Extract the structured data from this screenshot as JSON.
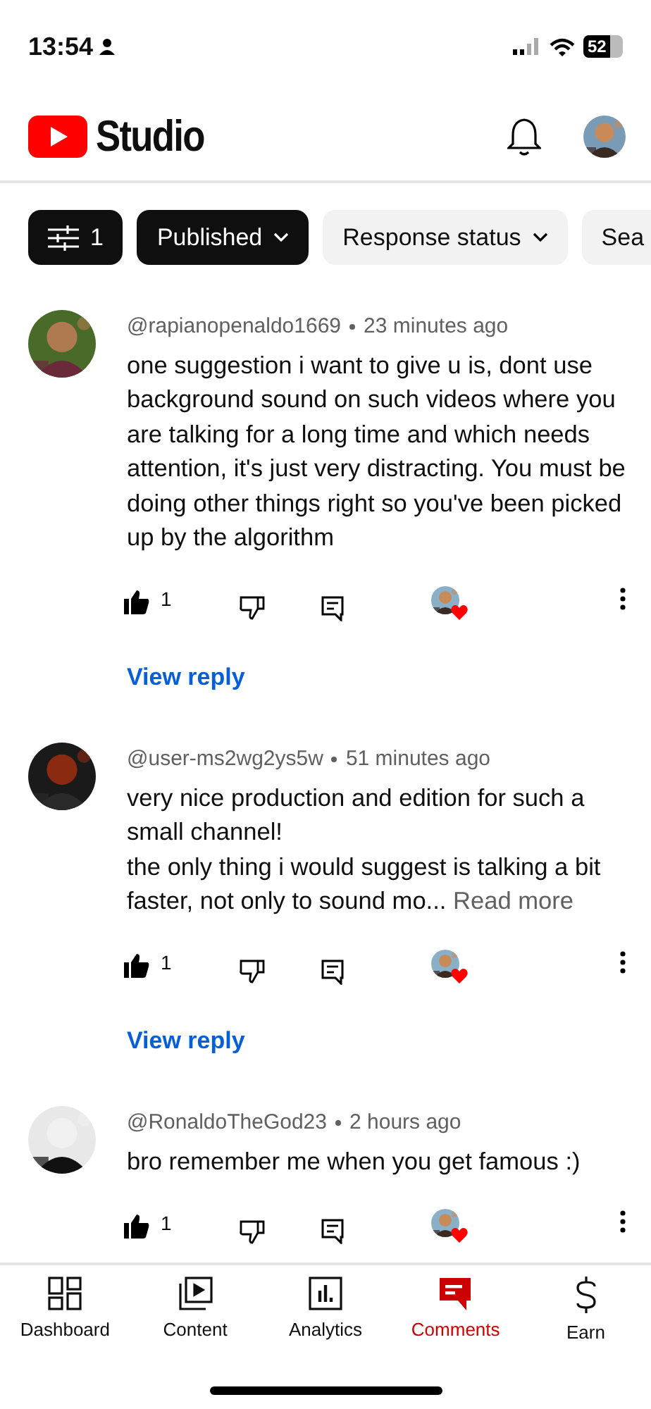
{
  "status_bar": {
    "time": "13:54",
    "battery": "52"
  },
  "header": {
    "title": "Studio"
  },
  "chips": [
    {
      "kind": "filter",
      "label": "1",
      "active": true
    },
    {
      "kind": "dropdown",
      "label": "Published",
      "active": true
    },
    {
      "kind": "dropdown",
      "label": "Response status",
      "active": false
    },
    {
      "kind": "text",
      "label": "Sea",
      "active": false
    }
  ],
  "comments": [
    {
      "author": "@rapianopenaldo1669",
      "time": "23 minutes ago",
      "text": "one suggestion i want to give u is, dont use background sound on such videos where you are talking for a long time and which needs attention, it's just very distracting. You must be doing other things right so you've been picked up by the algorithm",
      "likes": "1",
      "hearted": true,
      "view_reply": "View reply"
    },
    {
      "author": "@user-ms2wg2ys5w",
      "time": "51 minutes ago",
      "text": "very nice production and edition for such a small channel!\nthe only thing i would suggest is talking a bit faster, not only to sound mo...",
      "read_more": "Read more",
      "likes": "1",
      "hearted": true,
      "view_reply": "View reply"
    },
    {
      "author": "@RonaldoTheGod23",
      "time": "2 hours ago",
      "text": "bro remember me when you get famous :)",
      "likes": "1",
      "hearted": true
    }
  ],
  "nav": [
    {
      "kind": "dashboard",
      "label": "Dashboard",
      "selected": false
    },
    {
      "kind": "content",
      "label": "Content",
      "selected": false
    },
    {
      "kind": "analytics",
      "label": "Analytics",
      "selected": false
    },
    {
      "kind": "comments",
      "label": "Comments",
      "selected": true
    },
    {
      "kind": "earn",
      "label": "Earn",
      "selected": false
    }
  ]
}
